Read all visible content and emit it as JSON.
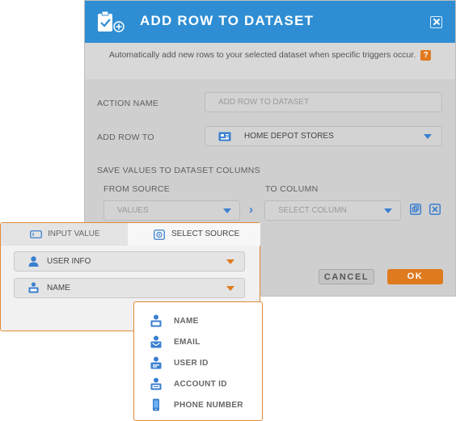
{
  "dialog": {
    "title": "ADD ROW TO DATASET",
    "description": "Automatically add new rows to your selected dataset when specific triggers occur.",
    "help_label": "?",
    "action_name_label": "ACTION NAME",
    "action_name_placeholder": "ADD ROW TO DATASET",
    "add_row_to_label": "ADD ROW TO",
    "add_row_to_value": "HOME DEPOT STORES",
    "save_values_label": "SAVE VALUES TO DATASET COLUMNS",
    "from_source_label": "FROM SOURCE",
    "to_column_label": "TO COLUMN",
    "values_placeholder": "VALUES",
    "select_column_placeholder": "SELECT COLUMN",
    "arrow_label": "›",
    "cancel_label": "CANCEL",
    "ok_label": "OK"
  },
  "source_panel": {
    "tabs": [
      {
        "label": "INPUT VALUE",
        "icon": "input-value-icon",
        "active": false
      },
      {
        "label": "SELECT SOURCE",
        "icon": "select-source-icon",
        "active": true
      }
    ],
    "source_value": "USER INFO",
    "field_value": "NAME"
  },
  "field_menu": {
    "items": [
      {
        "label": "NAME",
        "icon": "name-badge-icon"
      },
      {
        "label": "EMAIL",
        "icon": "email-badge-icon"
      },
      {
        "label": "USER ID",
        "icon": "user-id-badge-icon"
      },
      {
        "label": "ACCOUNT ID",
        "icon": "account-id-badge-icon"
      },
      {
        "label": "PHONE NUMBER",
        "icon": "phone-icon"
      }
    ]
  },
  "colors": {
    "header_blue": "#2f8ed3",
    "accent_orange": "#e07a1f",
    "icon_blue": "#3a7fd0"
  }
}
